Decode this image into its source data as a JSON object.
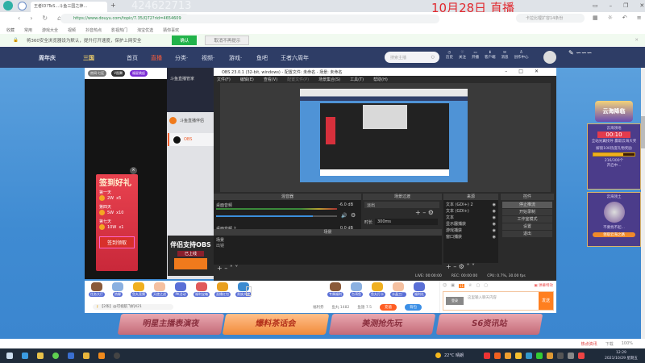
{
  "browser": {
    "tab_title": "王者ID?TeS…斗鱼三国之神…",
    "overlay_id": "424622713",
    "overlay_date": "10月28日 直播",
    "url": "https://www.douyu.com/topic/7.35/Q72?rid=4654609",
    "search_placeholder": "卡拉比锂扩容14条份",
    "bookmarks": [
      "收藏",
      "常用",
      "游戏大全",
      "视频",
      "抖音热点",
      "影视热门",
      "淘宝优选",
      "猜你喜欢"
    ],
    "notice_text": "将360安全浏览器设为默认，提升打开速度，保护上网安全",
    "notice_ok": "确认",
    "notice_no": "取消不再提示",
    "status_items": [
      "热点资讯",
      "下载",
      "100%"
    ]
  },
  "douyu_nav": {
    "logo": "周年庆",
    "sublogo": "三国",
    "items": [
      "首页",
      "直播",
      "分类·",
      "视频·",
      "游戏·",
      "鱼吧",
      "王者六周年"
    ],
    "active": "直播",
    "search_placeholder": "搜索主播",
    "icons": [
      "历史",
      "关注",
      "开播",
      "客户端",
      "消息",
      "创作中心"
    ]
  },
  "room": {
    "anchor_label": "房间·七区",
    "vip_badge": "V图腾",
    "tag": "福星跳起",
    "dropdown_title": "斗鱼直播管家",
    "dropdown_items": [
      "斗鱼直播伴侣",
      "OBS"
    ],
    "promo_title": "伴侣支持OBS",
    "promo_sub": "已上线"
  },
  "signin": {
    "title": "签到好礼",
    "days": [
      {
        "label": "第一天",
        "reward": "2W",
        "item": "x5"
      },
      {
        "label": "第四天",
        "reward": "5W",
        "item": "x10"
      },
      {
        "label": "第七天",
        "reward": "10W",
        "item": "x1"
      }
    ],
    "button": "签到领取"
  },
  "obs": {
    "title": "OBS 23.0.1 (32-bit, windows) - 配置文件: 未命名 - 场景: 未命名",
    "menu": [
      "文件(F)",
      "编辑(E)",
      "查看(V)",
      "配置文件(P)",
      "场景集合(S)",
      "工具(T)",
      "帮助(H)"
    ],
    "mixer": {
      "header": "混音器",
      "track1": "桌面音频",
      "db1": "-6.0 dB",
      "track2": "桌面音频 2",
      "db2": "0.0 dB"
    },
    "transitions": {
      "header": "场景过渡",
      "type": "淡出",
      "duration_label": "时长",
      "duration": "300ms"
    },
    "scenes": {
      "header": "场景",
      "col": "场景",
      "items": [
        "出镜"
      ]
    },
    "sources": {
      "header": "来源",
      "items": [
        "文本 (GDI+) 2",
        "文本 (GDI+)",
        "文本",
        "显示器捕获",
        "游戏捕获",
        "窗口捕获"
      ]
    },
    "controls": {
      "header": "控件",
      "buttons": [
        "停止推流",
        "开始录制",
        "工作室模式",
        "设置",
        "退出"
      ]
    },
    "status": {
      "live": "LIVE: 00:00:00",
      "rec": "REC: 00:00:00",
      "cpu": "CPU: 0.7%, 30.00 fps"
    },
    "mixer_volume": 0.8
  },
  "gifts": {
    "left": [
      "任务大厅",
      "热聊",
      "鱼丸竞猜",
      "天使之战",
      "PK活动",
      "福利宝箱",
      "直播红包",
      "贵族大使"
    ],
    "right": [
      "专属福利",
      "台湾鱼",
      "鱼丸打卡",
      "水晶工厂",
      "福利社"
    ],
    "announcement": "【2条】@可视航飞机X21",
    "stats": [
      "福利券",
      "鱼丸 1482",
      "鱼翅 7.5"
    ],
    "recharge": "充值",
    "backpack": "背包"
  },
  "chat": {
    "placeholder": "这里输入聊天内容",
    "hint": "弹幕特效",
    "send": "发送",
    "login": "登录",
    "badge": "11"
  },
  "banners": [
    "明星主播表演夜",
    "爆料茶话会",
    "美测抢先玩",
    "S6资讯站"
  ],
  "side_panel": {
    "title": "云海降临",
    "event": "云海领地",
    "timer": "00:10",
    "desc": "全站光翼找导 赢取云海大奖",
    "task": "解锁100热度礼物奖励",
    "progress_text": "216/300个",
    "progress": 0.72,
    "state": "开启中...",
    "card_title": "云海领土",
    "card_desc": "不要找不起...",
    "card_button": "领取云海之路"
  },
  "taskbar": {
    "weather": "22°C 晴朗",
    "time": "12:29",
    "date": "2021/10/29 星期五"
  },
  "colors": {
    "nav": "#2e3d66",
    "accent": "#ff5d23",
    "douyu_orange": "#ff7f1f",
    "obs_bg": "#2b2b2b",
    "page_blue": "#3f8bd2"
  }
}
